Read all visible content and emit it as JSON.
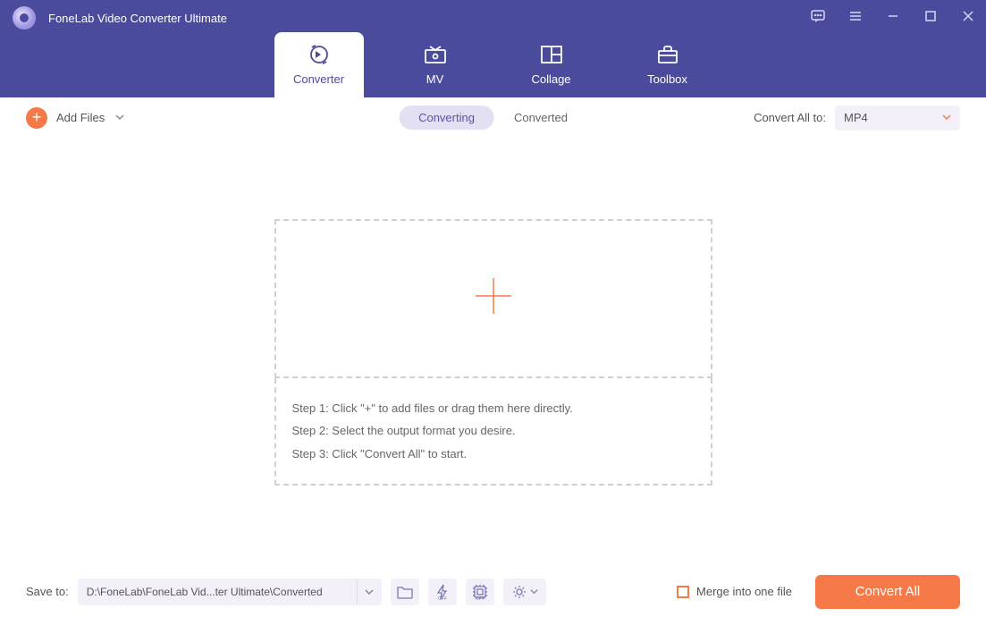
{
  "app": {
    "title": "FoneLab Video Converter Ultimate"
  },
  "nav": {
    "converter": "Converter",
    "mv": "MV",
    "collage": "Collage",
    "toolbox": "Toolbox"
  },
  "toolbar": {
    "add_files": "Add Files",
    "converting": "Converting",
    "converted": "Converted",
    "convert_all_to": "Convert All to:",
    "format": "MP4"
  },
  "dropzone": {
    "step1": "Step 1: Click \"+\" to add files or drag them here directly.",
    "step2": "Step 2: Select the output format you desire.",
    "step3": "Step 3: Click \"Convert All\" to start."
  },
  "bottom": {
    "save_to": "Save to:",
    "path": "D:\\FoneLab\\FoneLab Vid...ter Ultimate\\Converted",
    "merge": "Merge into one file",
    "convert_all": "Convert All"
  }
}
